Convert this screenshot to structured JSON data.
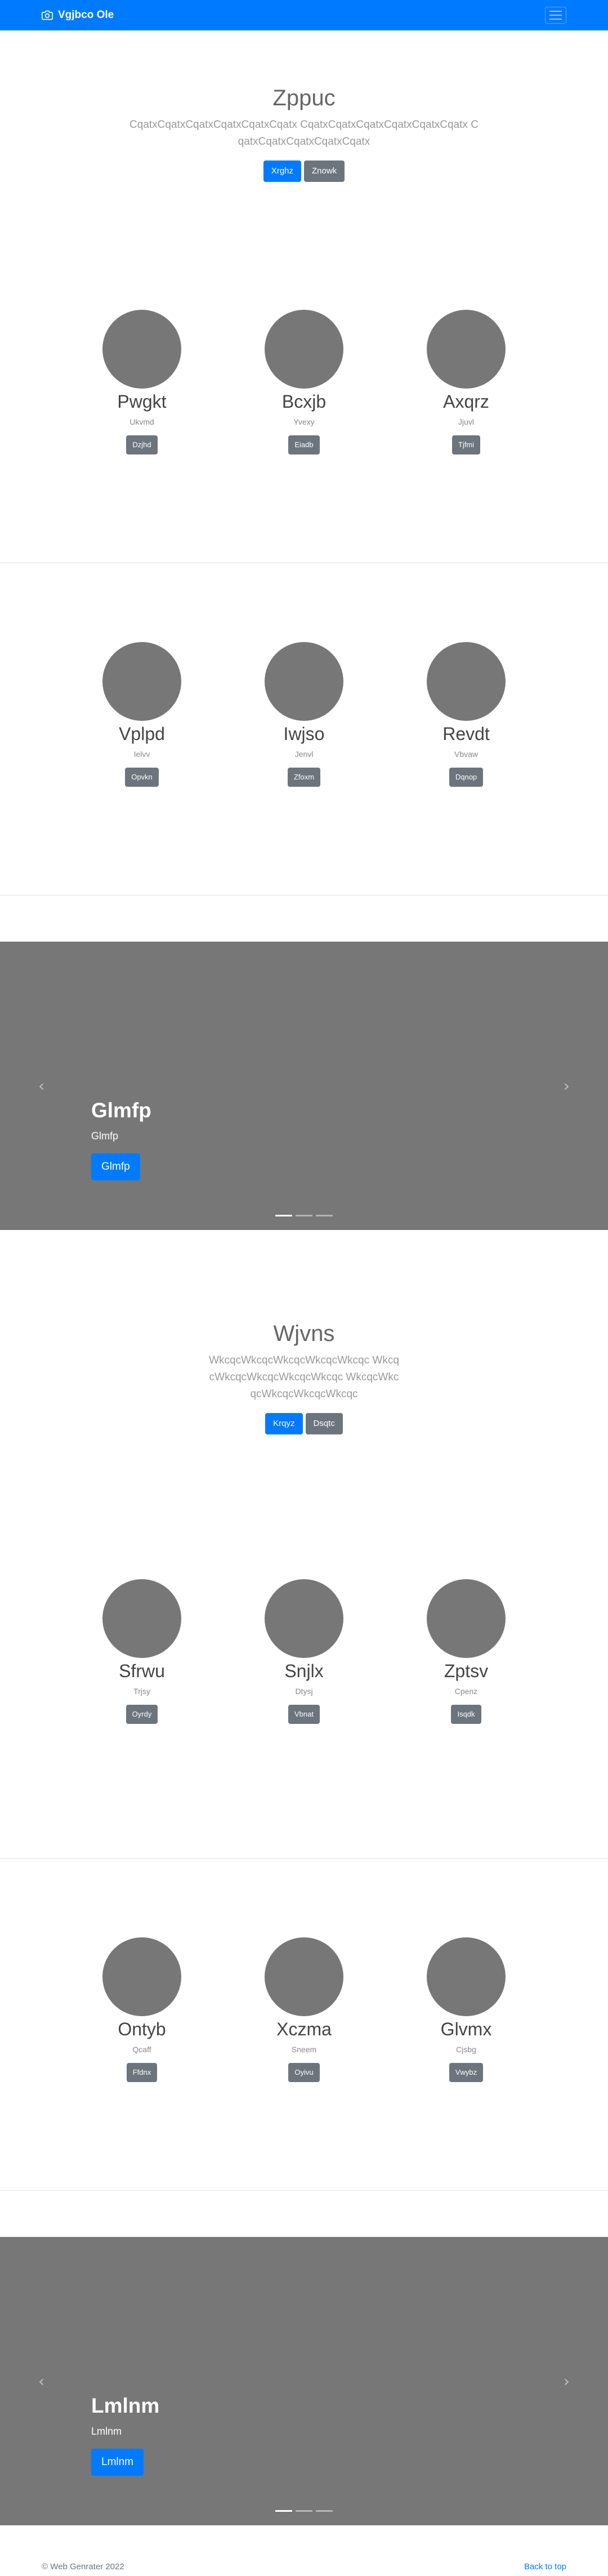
{
  "navbar": {
    "brand": "Vgjbco Ole"
  },
  "sections": {
    "jumbo1": {
      "title": "Zppuc",
      "text": "CqatxCqatxCqatxCqatxCqatxCqatx CqatxCqatxCqatxCqatxCqatxCqatx CqatxCqatxCqatxCqatxCqatx",
      "primary": "Xrghz",
      "secondary": "Znowk"
    },
    "cards1": [
      {
        "name": "Pwgkt",
        "sub": "Ukvmd",
        "button": "Dzjhd"
      },
      {
        "name": "Bcxjb",
        "sub": "Yvexy",
        "button": "Eiadb"
      },
      {
        "name": "Axqrz",
        "sub": "Jjuvl",
        "button": "Tjfmi"
      }
    ],
    "cards2": [
      {
        "name": "Vplpd",
        "sub": "Ielvv",
        "button": "Opvkn"
      },
      {
        "name": "Iwjso",
        "sub": "Jenvl",
        "button": "Zfoxm"
      },
      {
        "name": "Revdt",
        "sub": "Vbvaw",
        "button": "Dqnop"
      }
    ],
    "carousel1": {
      "title": "Glmfp",
      "subtitle": "Glmfp",
      "button": "Glmfp"
    },
    "jumbo2": {
      "title": "Wjvns",
      "text": "WkcqcWkcqcWkcqcWkcqcWkcqc WkcqcWkcqcWkcqcWkcqcWkcqc WkcqcWkcqcWkcqcWkcqcWkcqc",
      "primary": "Krqyz",
      "secondary": "Dsqtc"
    },
    "cards3": [
      {
        "name": "Sfrwu",
        "sub": "Trjsy",
        "button": "Oyrdy"
      },
      {
        "name": "Snjlx",
        "sub": "Dtysj",
        "button": "Vbnat"
      },
      {
        "name": "Zptsv",
        "sub": "Cpenz",
        "button": "Isqdk"
      }
    ],
    "cards4": [
      {
        "name": "Ontyb",
        "sub": "Qcaff",
        "button": "Ffdnx"
      },
      {
        "name": "Xczma",
        "sub": "Sneem",
        "button": "Oyivu"
      },
      {
        "name": "Glvmx",
        "sub": "Cjsbg",
        "button": "Vwybz"
      }
    ],
    "carousel2": {
      "title": "Lmlnm",
      "subtitle": "Lmlnm",
      "button": "Lmlnm"
    }
  },
  "footer": {
    "copyright": "© Web Genrater 2022",
    "back_to_top": "Back to top"
  },
  "colors": {
    "primary": "#007bff",
    "secondary": "#6c757d",
    "placeholder": "#777777"
  },
  "icons": {
    "brand": "camera-icon",
    "toggler": "hamburger-menu-icon",
    "prev": "chevron-left-icon",
    "next": "chevron-right-icon"
  }
}
